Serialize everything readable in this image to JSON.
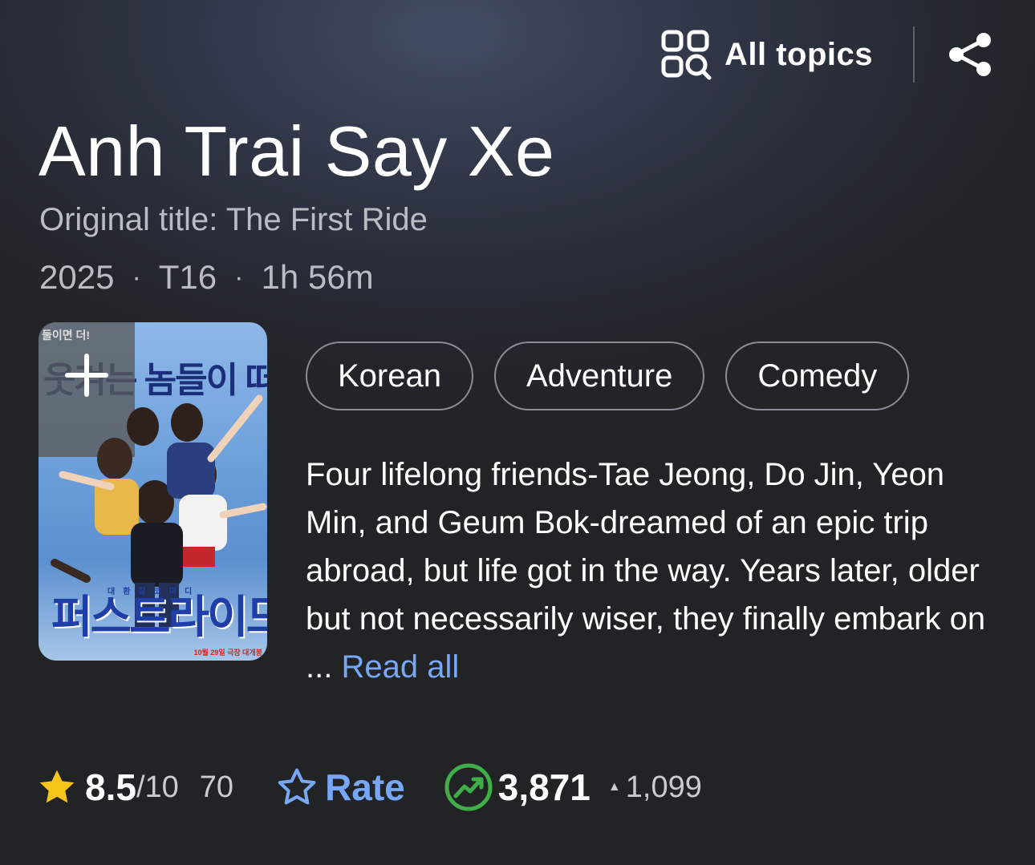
{
  "header": {
    "all_topics_label": "All topics"
  },
  "movie": {
    "title": "Anh Trai Say Xe",
    "original_title": "Original title: The First Ride",
    "year": "2025",
    "rating_cert": "T16",
    "runtime": "1h 56m",
    "meta_separator": "·"
  },
  "poster": {
    "banner_text": "웃겨는 놈들이 떠난다!",
    "tag_text": "둘이면 더!",
    "subline": "대환장코미디",
    "korean_title": "퍼스트라이드",
    "release_date": "10월 29일 극장 대개봉"
  },
  "genres": [
    "Korean",
    "Adventure",
    "Comedy"
  ],
  "description": {
    "text": "Four lifelong friends-Tae Jeong, Do Jin, Yeon Min, and Geum Bok-dreamed of an epic trip abroad, but life got in the way. Years later, older but not necessarily wiser, they finally embark on ... ",
    "read_all": "Read all"
  },
  "stats": {
    "rating": "8.5",
    "rating_max": "/10",
    "vote_count": "70",
    "rate_label": "Rate",
    "popularity": "3,871",
    "popularity_change": "1,099",
    "popularity_change_arrow": "▲"
  },
  "colors": {
    "accent_blue": "#78a7f5",
    "star_yellow": "#f5c518",
    "popularity_green": "#3fae49"
  },
  "icons": {
    "all_topics": "grid-search-icon",
    "share": "share-icon",
    "add": "plus-icon",
    "rating_star": "star-filled-icon",
    "rate_star": "star-outline-icon",
    "popularity": "trending-up-icon"
  }
}
